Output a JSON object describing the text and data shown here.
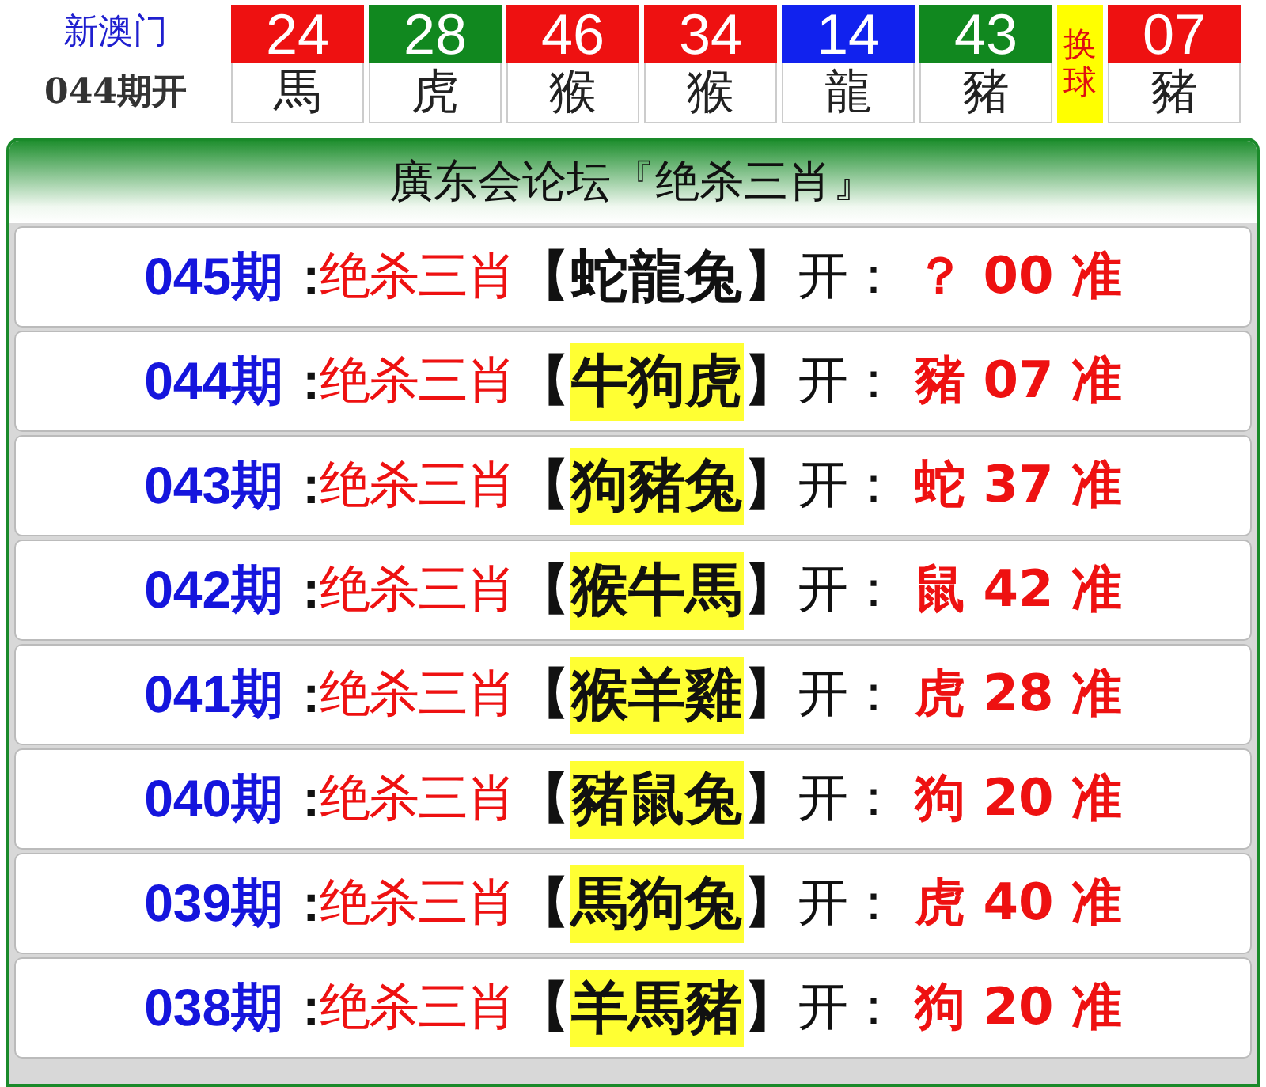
{
  "header": {
    "site": "新澳门",
    "period": "044期开",
    "balls": [
      {
        "number": "24",
        "zodiac": "馬",
        "color": "#ee1111"
      },
      {
        "number": "28",
        "zodiac": "虎",
        "color": "#11881f"
      },
      {
        "number": "46",
        "zodiac": "猴",
        "color": "#ee1111"
      },
      {
        "number": "34",
        "zodiac": "猴",
        "color": "#ee1111"
      },
      {
        "number": "14",
        "zodiac": "龍",
        "color": "#1122ee"
      },
      {
        "number": "43",
        "zodiac": "豬",
        "color": "#11881f"
      }
    ],
    "special_label": "换球",
    "special_ball": {
      "number": "07",
      "zodiac": "豬",
      "color": "#ee1111"
    }
  },
  "panel": {
    "title": "廣东会论坛『绝杀三肖』",
    "rows": [
      {
        "period": "045期",
        "colon": ":",
        "label": "绝杀三肖",
        "open_bracket": "【",
        "pick": "蛇龍兔",
        "highlighted": false,
        "close_bracket": "】",
        "open_label": "开：",
        "result": "？ 00 准"
      },
      {
        "period": "044期",
        "colon": ":",
        "label": "绝杀三肖",
        "open_bracket": "【",
        "pick": "牛狗虎",
        "highlighted": true,
        "close_bracket": "】",
        "open_label": "开：",
        "result": "豬 07 准"
      },
      {
        "period": "043期",
        "colon": ":",
        "label": "绝杀三肖",
        "open_bracket": "【",
        "pick": "狗豬兔",
        "highlighted": true,
        "close_bracket": "】",
        "open_label": "开：",
        "result": "蛇 37 准"
      },
      {
        "period": "042期",
        "colon": ":",
        "label": "绝杀三肖",
        "open_bracket": "【",
        "pick": "猴牛馬",
        "highlighted": true,
        "close_bracket": "】",
        "open_label": "开：",
        "result": "鼠 42 准"
      },
      {
        "period": "041期",
        "colon": ":",
        "label": "绝杀三肖",
        "open_bracket": "【",
        "pick": "猴羊雞",
        "highlighted": true,
        "close_bracket": "】",
        "open_label": "开：",
        "result": "虎 28 准"
      },
      {
        "period": "040期",
        "colon": ":",
        "label": "绝杀三肖",
        "open_bracket": "【",
        "pick": "豬鼠兔",
        "highlighted": true,
        "close_bracket": "】",
        "open_label": "开：",
        "result": "狗 20 准"
      },
      {
        "period": "039期",
        "colon": ":",
        "label": "绝杀三肖",
        "open_bracket": "【",
        "pick": "馬狗兔",
        "highlighted": true,
        "close_bracket": "】",
        "open_label": "开：",
        "result": "虎 40 准"
      },
      {
        "period": "038期",
        "colon": ":",
        "label": "绝杀三肖",
        "open_bracket": "【",
        "pick": "羊馬豬",
        "highlighted": true,
        "close_bracket": "】",
        "open_label": "开：",
        "result": "狗 20 准"
      }
    ]
  }
}
